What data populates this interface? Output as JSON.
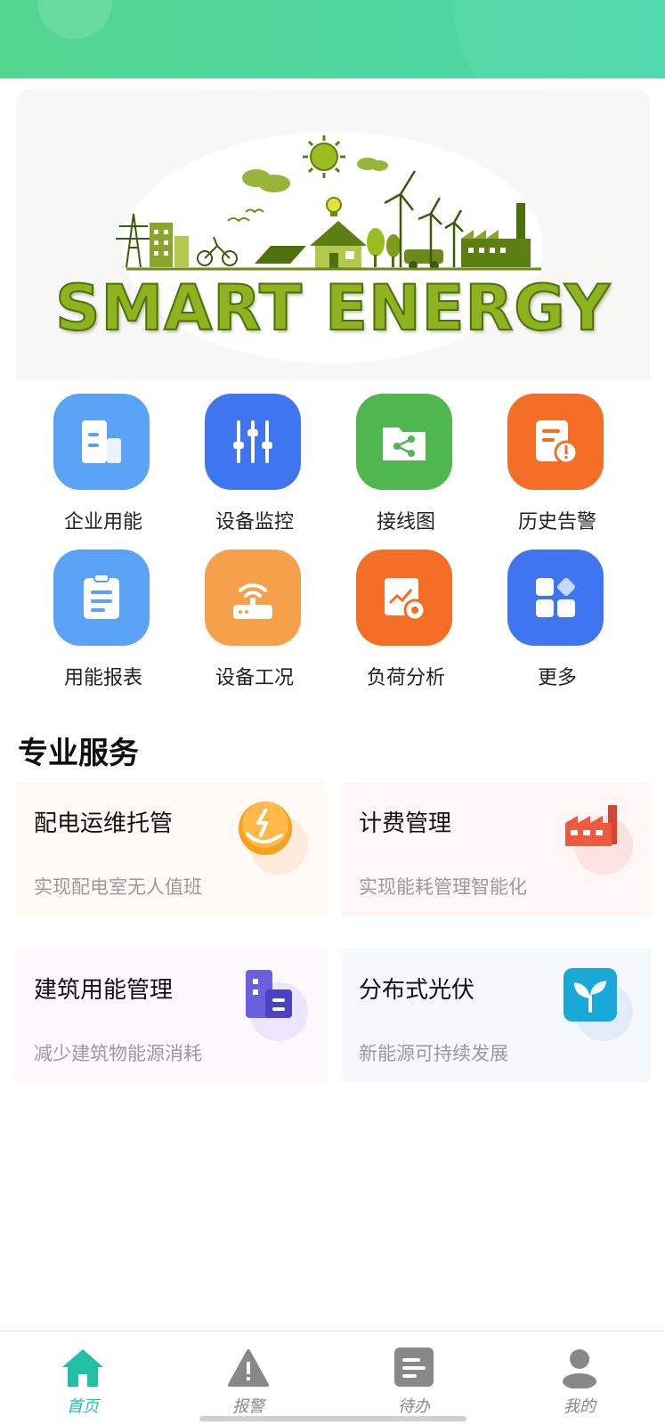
{
  "banner": {
    "text": "SMART ENERGY"
  },
  "quick_actions": [
    {
      "label": "企业用能",
      "icon": "building-icon",
      "color": "#5aa2f6"
    },
    {
      "label": "设备监控",
      "icon": "sliders-icon",
      "color": "#3f76f0"
    },
    {
      "label": "接线图",
      "icon": "share-folder-icon",
      "color": "#4fb650"
    },
    {
      "label": "历史告警",
      "icon": "alert-document-icon",
      "color": "#f46e26"
    },
    {
      "label": "用能报表",
      "icon": "clipboard-icon",
      "color": "#5aa2f6"
    },
    {
      "label": "设备工况",
      "icon": "router-icon",
      "color": "#f5a04a"
    },
    {
      "label": "负荷分析",
      "icon": "chart-gear-icon",
      "color": "#f46e26"
    },
    {
      "label": "更多",
      "icon": "grid-more-icon",
      "color": "#3f76f0"
    }
  ],
  "services": {
    "title": "专业服务",
    "items": [
      {
        "title": "配电运维托管",
        "subtitle": "实现配电室无人值班",
        "icon": "hand-lightning-icon",
        "bg": "#fffaf6"
      },
      {
        "title": "计费管理",
        "subtitle": "实现能耗管理智能化",
        "icon": "factory-icon",
        "bg": "#fff6f6"
      },
      {
        "title": "建筑用能管理",
        "subtitle": "减少建筑物能源消耗",
        "icon": "buildings-icon",
        "bg": "#fcf8fe"
      },
      {
        "title": "分布式光伏",
        "subtitle": "新能源可持续发展",
        "icon": "sprout-icon",
        "bg": "#f5f8fd"
      }
    ]
  },
  "tabbar": {
    "active_color": "#21c0a5",
    "items": [
      {
        "label": "首页",
        "icon": "home-icon",
        "active": true
      },
      {
        "label": "报警",
        "icon": "warning-icon",
        "active": false
      },
      {
        "label": "待办",
        "icon": "todo-list-icon",
        "active": false
      },
      {
        "label": "我的",
        "icon": "user-icon",
        "active": false
      }
    ]
  }
}
